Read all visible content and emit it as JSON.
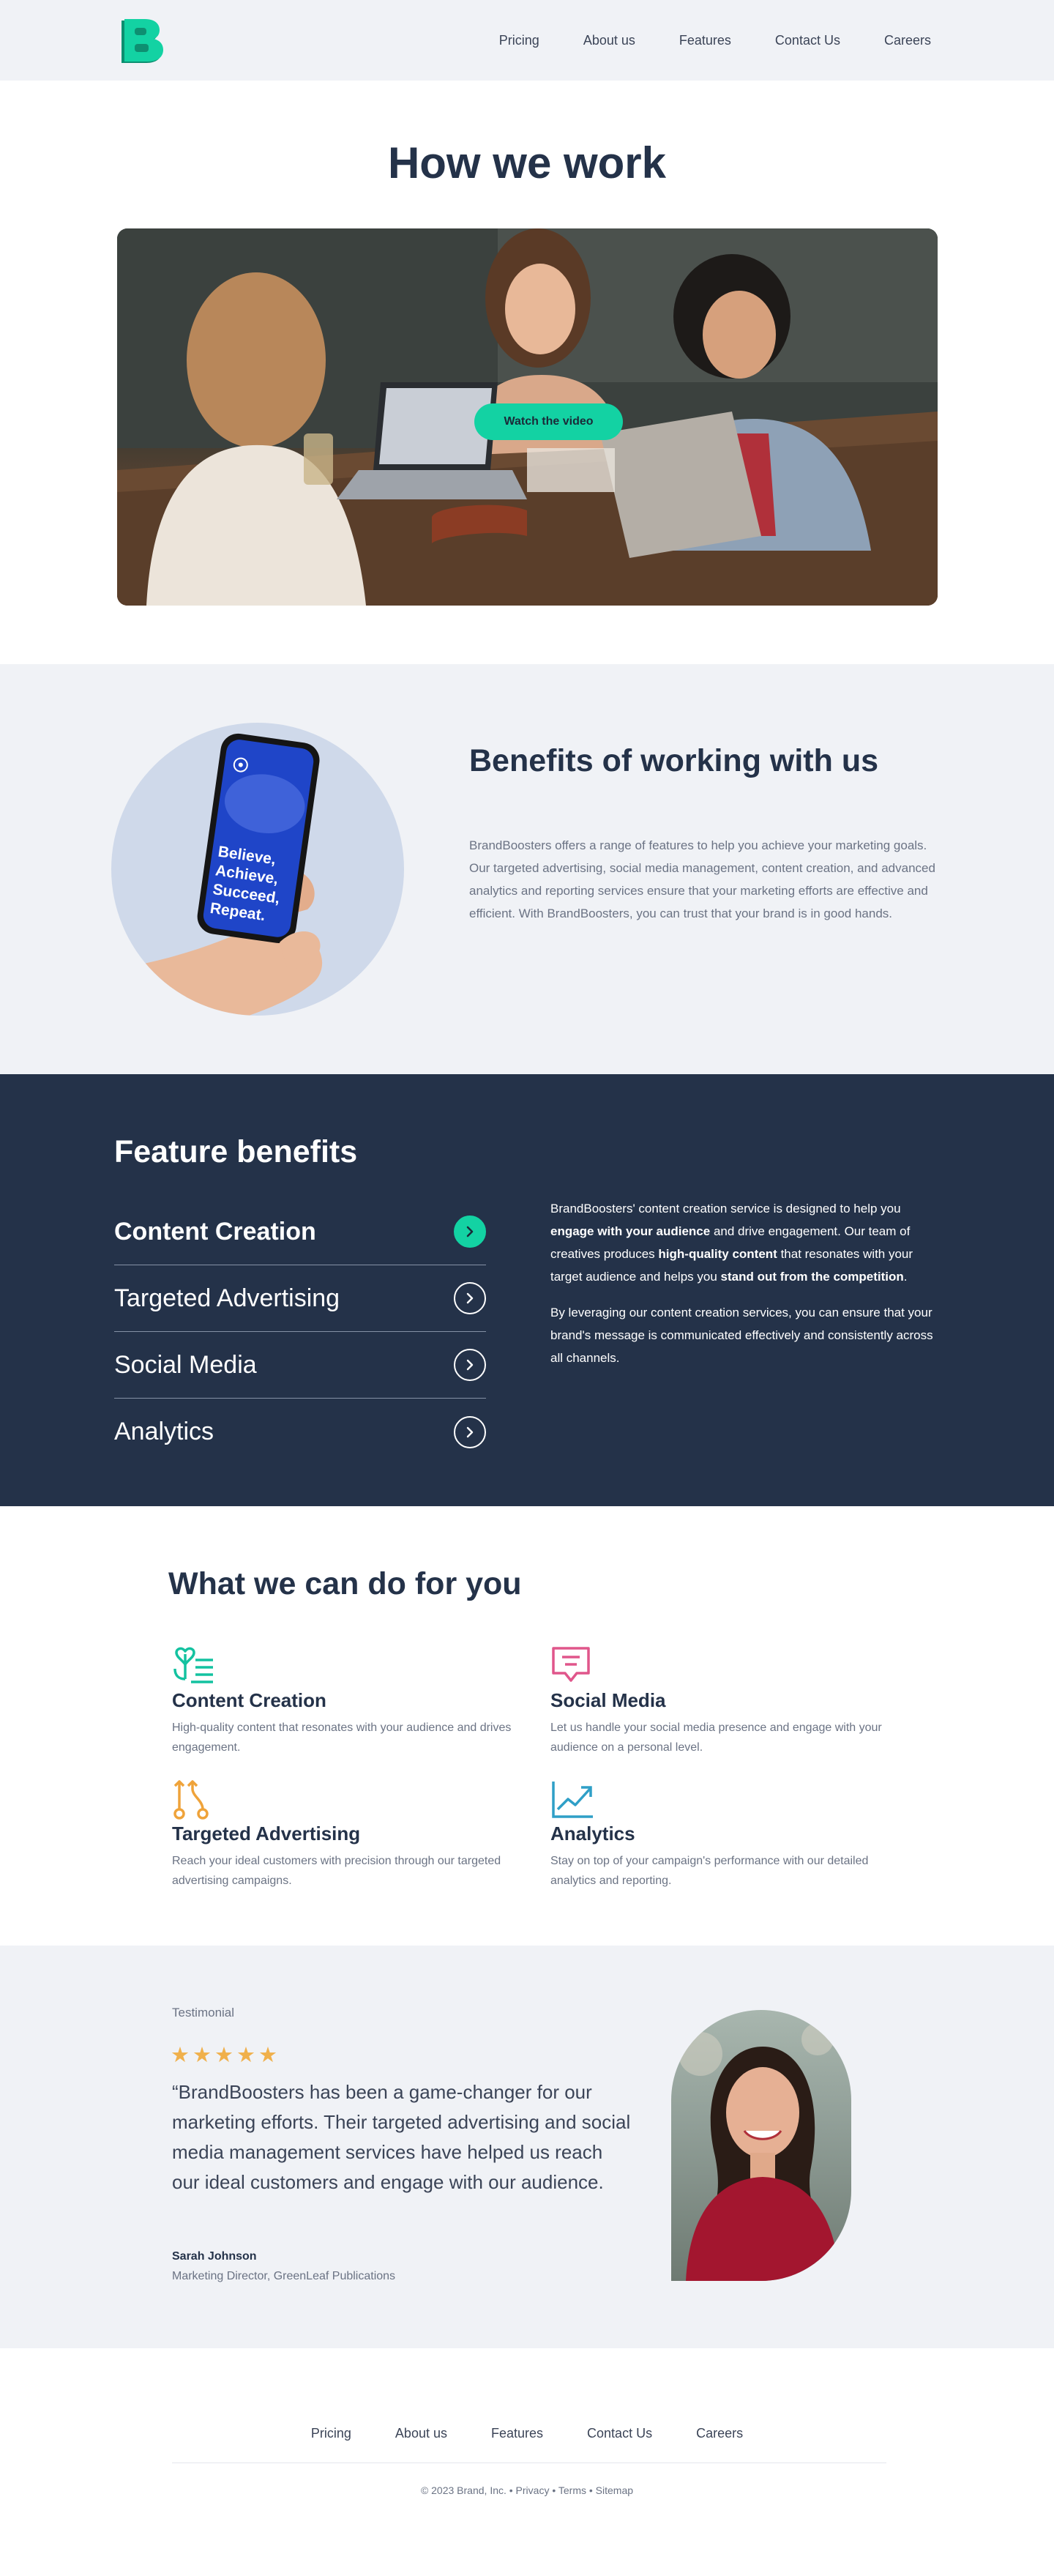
{
  "nav": {
    "logo_letter": "B",
    "links": [
      "Pricing",
      "About us",
      "Features",
      "Contact Us",
      "Careers"
    ]
  },
  "how": {
    "title": "How we work",
    "video_button": "Watch the video"
  },
  "benefits": {
    "title": "Benefits of working with us",
    "body": "BrandBoosters offers a range of features to help you achieve your marketing goals. Our targeted advertising, social media management, content creation, and advanced analytics and reporting services ensure that your marketing efforts are effective and efficient. With BrandBoosters, you can trust that your brand is in good hands.",
    "phone_text": [
      "Believe,",
      "Achieve,",
      "Succeed,",
      "Repeat."
    ]
  },
  "features": {
    "title": "Feature benefits",
    "items": [
      {
        "label": "Content Creation",
        "active": true
      },
      {
        "label": "Targeted Advertising",
        "active": false
      },
      {
        "label": "Social Media",
        "active": false
      },
      {
        "label": "Analytics",
        "active": false
      }
    ],
    "desc_p1": [
      "BrandBoosters' content creation service is designed to help you ",
      "engage with your audience",
      " and drive engagement. Our team of creatives produces ",
      "high-quality content",
      " that resonates with your target audience and helps you ",
      "stand out from the competition",
      "."
    ],
    "desc_p2": "By leveraging our content creation services, you can ensure that your brand's message is communicated effectively and consistently across all channels."
  },
  "whatwe": {
    "title": "What we can do for you",
    "services": [
      {
        "title": "Content Creation",
        "desc": "High-quality content that resonates with your audience and drives engagement.",
        "icon": "content-icon",
        "color": "#13c2a0"
      },
      {
        "title": "Social Media",
        "desc": "Let us handle your social media presence and engage with your audience on a personal level.",
        "icon": "chat-icon",
        "color": "#e0568b"
      },
      {
        "title": "Targeted Advertising",
        "desc": "Reach your ideal customers with precision through our targeted advertising campaigns.",
        "icon": "route-icon",
        "color": "#efa33a"
      },
      {
        "title": "Analytics",
        "desc": "Stay on top of your campaign's performance with our detailed analytics and reporting.",
        "icon": "trend-icon",
        "color": "#2f9fc7"
      }
    ]
  },
  "testimonial": {
    "label": "Testimonial",
    "rating": 5,
    "stars": "★★★★★",
    "quote": "“BrandBoosters has been a game-changer for our marketing efforts. Their targeted advertising and social media management services have helped us reach our ideal customers and engage with our audience.",
    "name": "Sarah Johnson",
    "role": "Marketing Director, GreenLeaf Publications"
  },
  "footer": {
    "links": [
      "Pricing",
      "About us",
      "Features",
      "Contact Us",
      "Careers"
    ],
    "copyright": "© 2023 Brand, Inc. • Privacy • Terms • Sitemap"
  },
  "colors": {
    "accent": "#13d2a3",
    "navy": "#243249",
    "light_bg": "#f0f2f6",
    "star": "#f0b04b"
  }
}
